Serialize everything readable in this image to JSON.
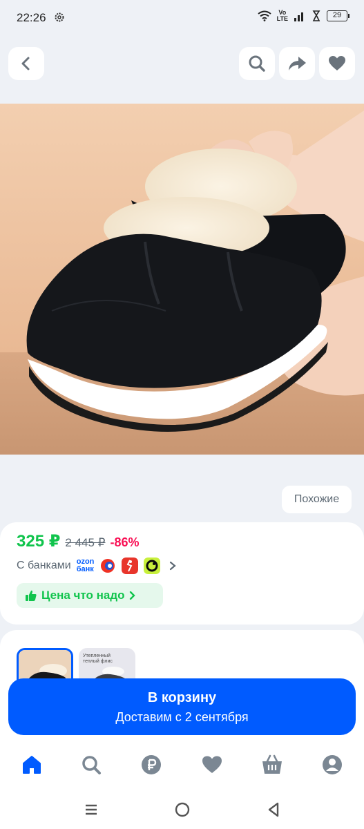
{
  "status_bar": {
    "time": "22:26",
    "network_label_top": "Vo",
    "network_label_bottom": "LTE",
    "battery": "29"
  },
  "header": {
    "icons": [
      "back-icon",
      "search-icon",
      "share-icon",
      "heart-icon"
    ]
  },
  "gallery": {
    "similar_label": "Похожие"
  },
  "price": {
    "current": "325 ₽",
    "old": "2 445 ₽",
    "discount": "-86%"
  },
  "banks": {
    "label": "С банками",
    "ozon_line1": "ozon",
    "ozon_line2": "банк"
  },
  "deal_badge": {
    "label": "Цена что надо"
  },
  "variants": {
    "thumb2_caption_line1": "Утепленный",
    "thumb2_caption_line2": "теплый флис"
  },
  "cart_button": {
    "title": "В корзину",
    "subtitle": "Доставим с 2 сентября"
  },
  "bottom_nav": {
    "items": [
      "home-icon",
      "search-icon",
      "ruble-icon",
      "favorites-icon",
      "cart-icon",
      "profile-icon"
    ]
  },
  "colors": {
    "accent": "#005bff",
    "price_green": "#10c44c",
    "discount_red": "#f91155"
  }
}
